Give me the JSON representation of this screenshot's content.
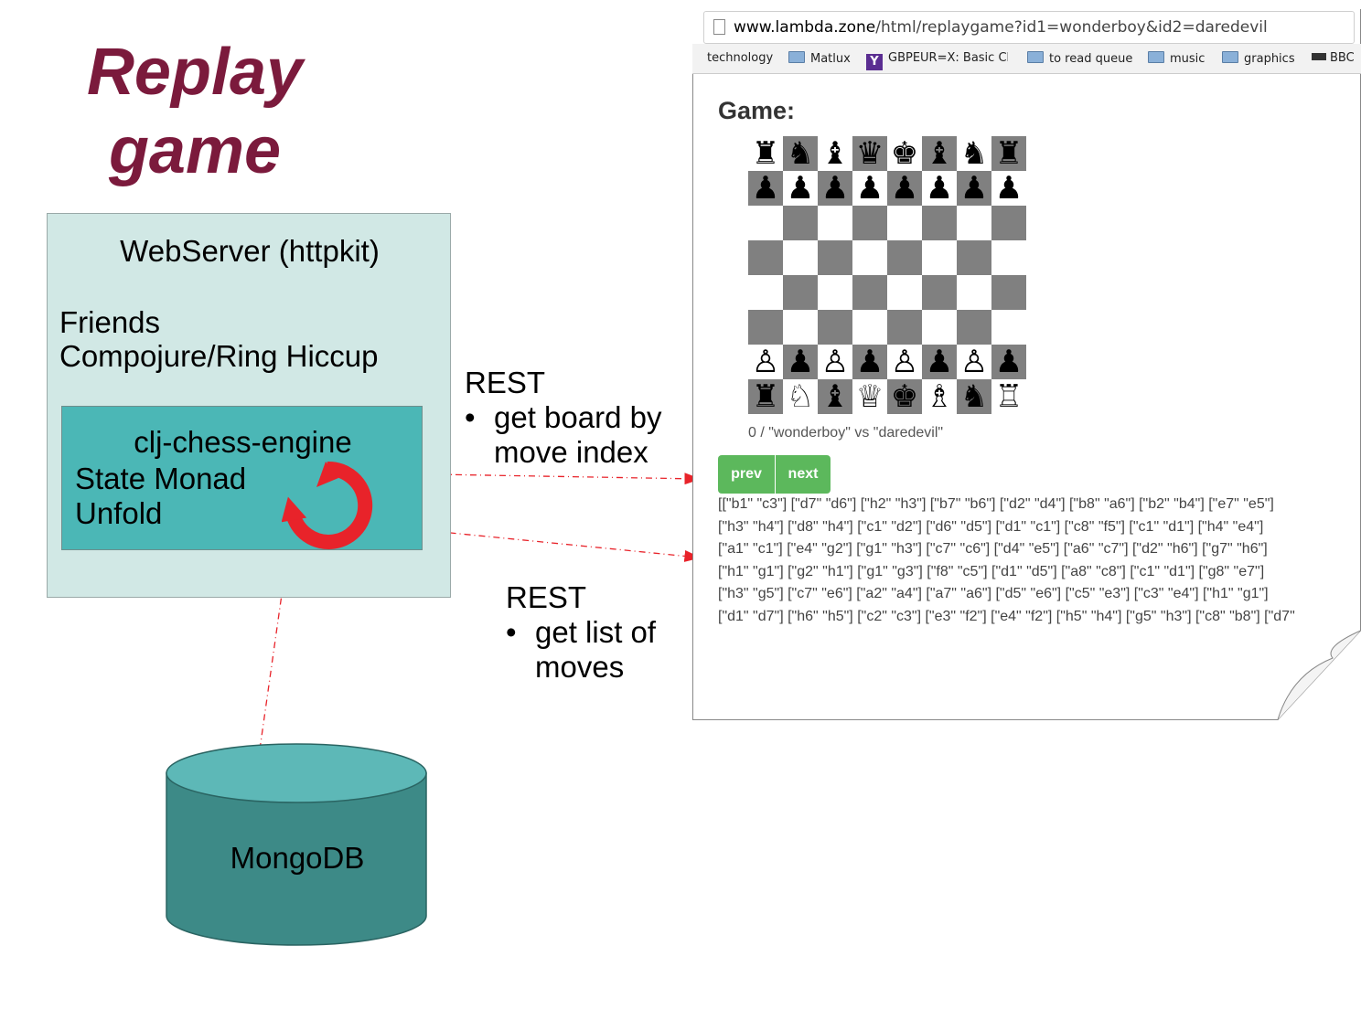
{
  "diagram": {
    "title": "Replay\ngame",
    "webserver": {
      "title": "WebServer (httpkit)",
      "lines": [
        "Friends",
        "Compojure/Ring Hiccup"
      ],
      "engine": {
        "title": "clj-chess-engine",
        "lines": [
          "State Monad",
          "Unfold"
        ]
      }
    },
    "rest_board": {
      "heading": "REST",
      "bullet_line1": "get board by",
      "bullet_line2": "move index"
    },
    "rest_moves": {
      "heading": "REST",
      "bullet_line1": "get list of",
      "bullet_line2": "moves"
    },
    "database": {
      "label": "MongoDB"
    },
    "colors": {
      "title": "#7b1a3c",
      "webserver_fill": "#d1e8e5",
      "engine_fill": "#4bb7b6",
      "db_top": "#5db8b7",
      "db_body": "#3d8a87",
      "arrow": "#e8232a"
    }
  },
  "browser": {
    "url_prefix": "www.lambda.zone",
    "url_rest": "/html/replaygame?id1=wonderboy&id2=daredevil",
    "bookmarks": [
      {
        "label": "technology",
        "icon": "none"
      },
      {
        "label": "Matlux",
        "icon": "folder-icon"
      },
      {
        "label": "GBPEUR=X: Basic Ch",
        "icon": "yahoo-icon"
      },
      {
        "label": "to read queue",
        "icon": "folder-icon"
      },
      {
        "label": "music",
        "icon": "folder-icon"
      },
      {
        "label": "graphics",
        "icon": "folder-icon"
      },
      {
        "label": "BBC",
        "icon": "bbc-icon"
      }
    ],
    "game_label": "Game:",
    "board": [
      [
        "♜",
        "♞",
        "♝",
        "♛",
        "♚",
        "♝",
        "♞",
        "♜"
      ],
      [
        "♟",
        "♟",
        "♟",
        "♟",
        "♟",
        "♟",
        "♟",
        "♟"
      ],
      [
        "",
        "",
        "",
        "",
        "",
        "",
        "",
        ""
      ],
      [
        "",
        "",
        "",
        "",
        "",
        "",
        "",
        ""
      ],
      [
        "",
        "",
        "",
        "",
        "",
        "",
        "",
        ""
      ],
      [
        "",
        "",
        "",
        "",
        "",
        "",
        "",
        ""
      ],
      [
        "♙",
        "♟",
        "♙",
        "♟",
        "♙",
        "♟",
        "♙",
        "♟"
      ],
      [
        "♜",
        "♘",
        "♝",
        "♕",
        "♚",
        "♗",
        "♞",
        "♖"
      ]
    ],
    "caption": "0 / \"wonderboy\" vs \"daredevil\"",
    "prev_label": "prev",
    "next_label": "next",
    "moves_lines": [
      "[[\"b1\" \"c3\"] [\"d7\" \"d6\"] [\"h2\" \"h3\"] [\"b7\" \"b6\"] [\"d2\" \"d4\"] [\"b8\" \"a6\"] [\"b2\" \"b4\"] [\"e7\" \"e5\"]",
      "[\"h3\" \"h4\"] [\"d8\" \"h4\"] [\"c1\" \"d2\"] [\"d6\" \"d5\"] [\"d1\" \"c1\"] [\"c8\" \"f5\"] [\"c1\" \"d1\"] [\"h4\" \"e4\"]",
      "[\"a1\" \"c1\"] [\"e4\" \"g2\"] [\"g1\" \"h3\"] [\"c7\" \"c6\"] [\"d4\" \"e5\"] [\"a6\" \"c7\"] [\"d2\" \"h6\"] [\"g7\" \"h6\"]",
      "[\"h1\" \"g1\"] [\"g2\" \"h1\"] [\"g1\" \"g3\"] [\"f8\" \"c5\"] [\"d1\" \"d5\"] [\"a8\" \"c8\"] [\"c1\" \"d1\"] [\"g8\" \"e7\"]",
      "[\"h3\" \"g5\"] [\"c7\" \"e6\"] [\"a2\" \"a4\"] [\"a7\" \"a6\"] [\"d5\" \"e6\"] [\"c5\" \"e3\"] [\"c3\" \"e4\"] [\"h1\" \"g1\"]",
      "[\"d1\" \"d7\"] [\"h6\" \"h5\"] [\"c2\" \"c3\"] [\"e3\" \"f2\"] [\"e4\" \"f2\"] [\"h5\" \"h4\"] [\"g5\" \"h3\"] [\"c8\" \"b8\"] [\"d7\""
    ]
  }
}
